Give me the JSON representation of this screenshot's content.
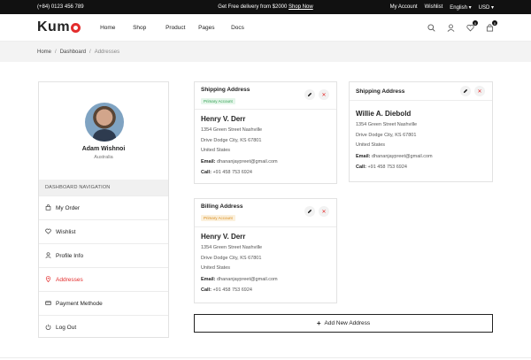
{
  "topbar": {
    "phone": "(+84) 0123 456 789",
    "promo_text": "Get Free delivery from $2000",
    "promo_link": "Shop Now",
    "account": "My Account",
    "wishlist": "Wishlist",
    "language": "English",
    "currency": "USD"
  },
  "header": {
    "logo": "Kum",
    "nav": [
      "Home",
      "Shop",
      "Product",
      "Pages",
      "Docs"
    ],
    "wishlist_count": "0",
    "cart_count": "0"
  },
  "breadcrumb": {
    "items": [
      "Home",
      "Dashboard",
      "Addresses"
    ],
    "separator": "/"
  },
  "sidebar": {
    "user_name": "Adam Wishnoi",
    "user_country": "Australia",
    "nav_heading": "DASHBOARD NAVIGATION",
    "items": [
      {
        "label": "My Order",
        "icon": "bag-icon"
      },
      {
        "label": "Wishlist",
        "icon": "heart-icon"
      },
      {
        "label": "Profile Info",
        "icon": "user-icon"
      },
      {
        "label": "Addresses",
        "icon": "location-pin-icon",
        "active": true
      },
      {
        "label": "Payment Methode",
        "icon": "card-icon"
      },
      {
        "label": "Log Out",
        "icon": "power-icon"
      }
    ]
  },
  "cards": [
    {
      "title": "Shipping Address",
      "tag": "Primary Account",
      "name": "Henry V. Derr",
      "line1": "1354 Green Street Nashville",
      "line2": "Drive Dodge City, KS 67801",
      "line3": "United States",
      "email_label": "Email:",
      "email": "dhananjaypreet@gmail.com",
      "call_label": "Call:",
      "call": "+91 458 753 6924"
    },
    {
      "title": "Billing Address",
      "tag": "Primary Account",
      "name": "Henry V. Derr",
      "line1": "1354 Green Street Nashville",
      "line2": "Drive Dodge City, KS 67801",
      "line3": "United States",
      "email_label": "Email:",
      "email": "dhananjaypreet@gmail.com",
      "call_label": "Call:",
      "call": "+91 458 753 6924"
    },
    {
      "title": "Shipping Address",
      "name": "Willie A. Diebold",
      "line1": "1354 Green Street Nashville",
      "line2": "Drive Dodge City, KS 67801",
      "line3": "United States",
      "email_label": "Email:",
      "email": "dhananjaypreet@gmail.com",
      "call_label": "Call:",
      "call": "+91 458 753 6924"
    }
  ],
  "add_button": "Add New Address",
  "colors": {
    "accent": "#e32d2d",
    "primary_tag": "#2e9e4f",
    "billing_tag": "#d98b1a",
    "topbar": "#111111"
  }
}
